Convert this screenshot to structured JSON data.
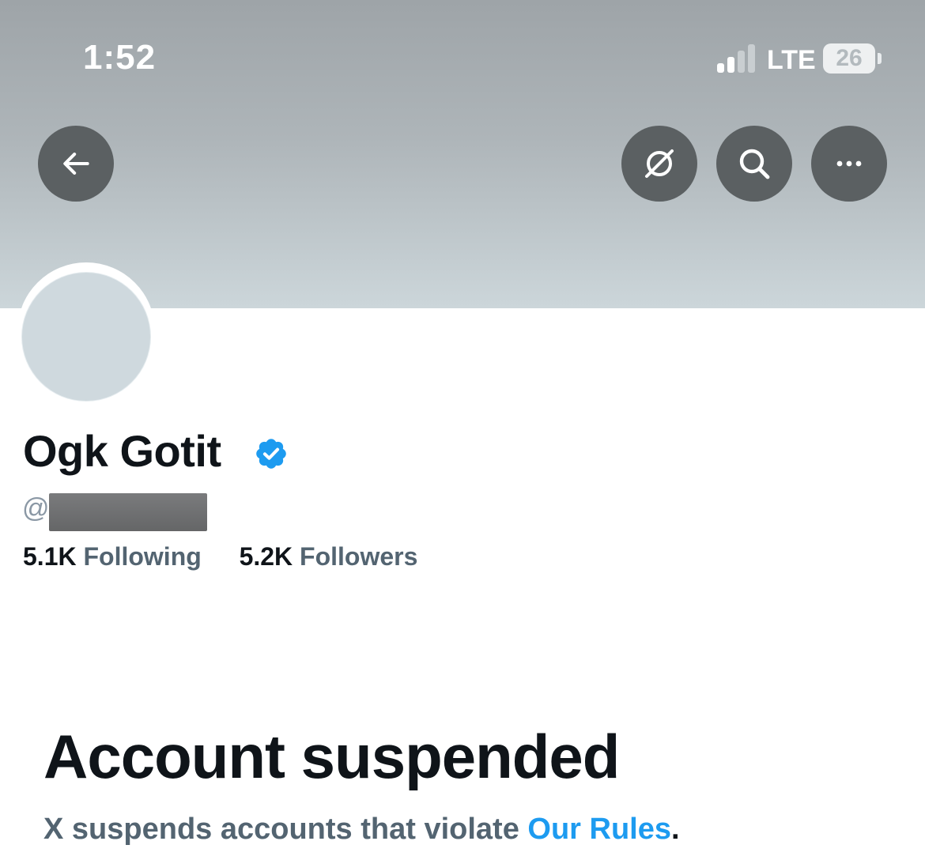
{
  "status_bar": {
    "time": "1:52",
    "network": "LTE",
    "battery": "26"
  },
  "header": {
    "back_icon": "arrow-left-icon",
    "actions": [
      "grok-icon",
      "search-icon",
      "more-icon"
    ]
  },
  "profile": {
    "display_name": "Ogk Gotit",
    "verified": true,
    "handle_prefix": "@",
    "following_count": "5.1K",
    "following_label": "Following",
    "followers_count": "5.2K",
    "followers_label": "Followers"
  },
  "suspension": {
    "title": "Account suspended",
    "text_prefix": "X suspends accounts that violate ",
    "link_text": "Our Rules",
    "text_suffix": "."
  },
  "colors": {
    "accent": "#1d9bf0",
    "text_primary": "#0f1419",
    "text_secondary": "#536471",
    "header_button": "#5b6062"
  }
}
